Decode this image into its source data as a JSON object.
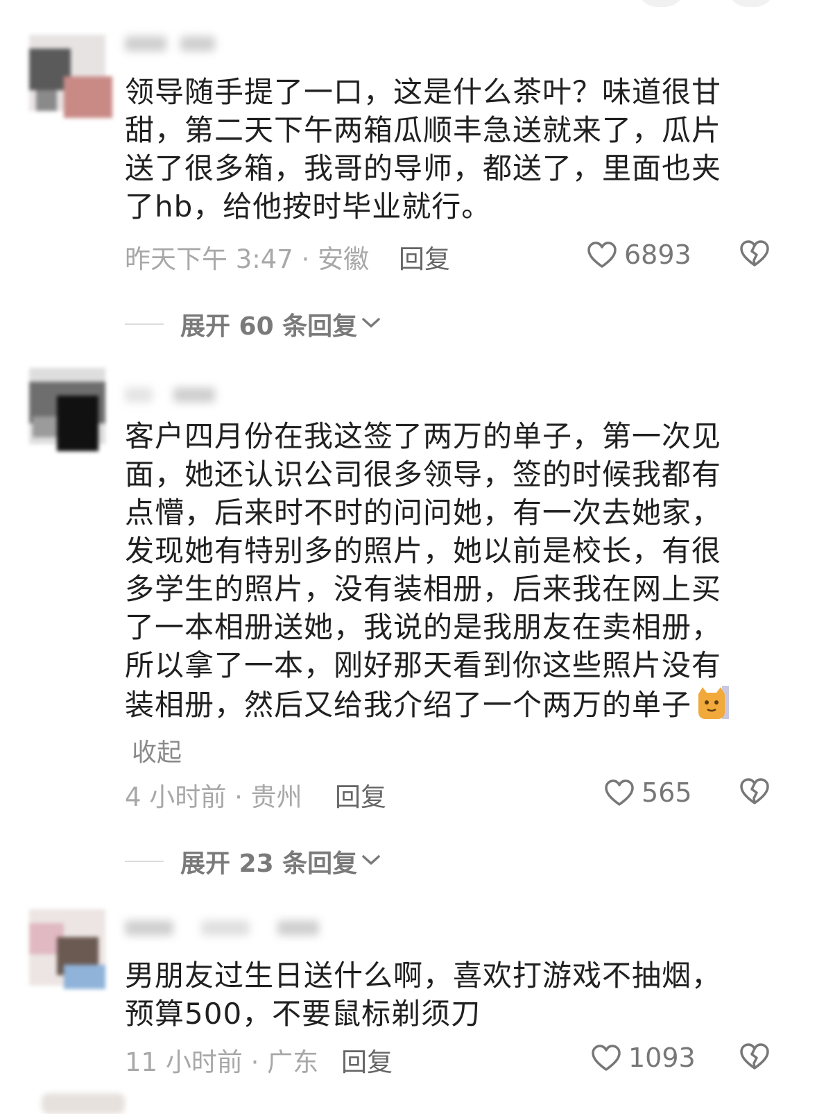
{
  "comments": [
    {
      "text": "领导随手提了一口，这是什么茶叶？味道很甘甜，第二天下午两箱瓜顺丰急送就来了，瓜片送了很多箱，我哥的导师，都送了，里面也夹了hb，给他按时毕业就行。",
      "meta": "昨天下午 3:47 · 安徽",
      "reply_label": "回复",
      "likes": "6893",
      "expand_label": "展开 60 条回复"
    },
    {
      "text": "客户四月份在我这签了两万的单子，第一次见面，她还认识公司很多领导，签的时候我都有点懵，后来时不时的问问她，有一次去她家，发现她有特别多的照片，她以前是校长，有很多学生的照片，没有装相册，后来我在网上买了一本相册送她，我说的是我朋友在卖相册，所以拿了一本，刚好那天看到你这些照片没有装相册，然后又给我介绍了一个两万的单子",
      "collapse_label": "收起",
      "meta": "4 小时前 · 贵州",
      "reply_label": "回复",
      "likes": "565",
      "expand_label": "展开 23 条回复"
    },
    {
      "text": "男朋友过生日送什么啊，喜欢打游戏不抽烟，预算500，不要鼠标剃须刀",
      "meta": "11 小时前 · 广东",
      "reply_label": "回复",
      "likes": "1093"
    }
  ],
  "icons": {
    "like": "heart-outline-icon",
    "dislike": "broken-heart-icon",
    "expand": "chevron-down-icon",
    "emoji": "cat-emoji-icon"
  },
  "colors": {
    "text": "#202020",
    "meta": "#a8a8a8",
    "reply": "#666666",
    "expand": "#7a7a7a"
  }
}
